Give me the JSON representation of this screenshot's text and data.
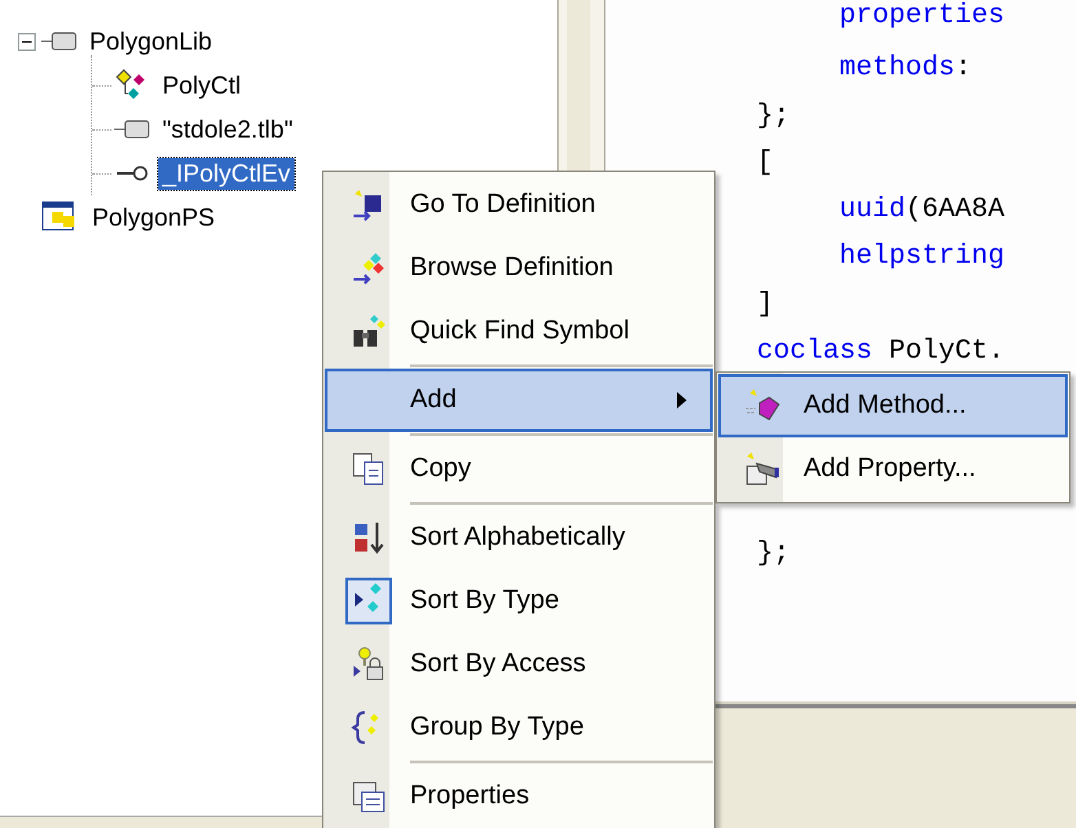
{
  "tree": {
    "nodes": [
      {
        "label": "PolygonLib",
        "kind": "library",
        "expanded": true,
        "selected": false,
        "children": [
          {
            "label": "PolyCtl",
            "kind": "coclass",
            "selected": false
          },
          {
            "label": "\"stdole2.tlb\"",
            "kind": "library",
            "selected": false
          },
          {
            "label": "_IPolyCtlEv",
            "kind": "interface",
            "selected": true
          }
        ]
      },
      {
        "label": "PolygonPS",
        "kind": "project",
        "selected": false
      }
    ]
  },
  "code": {
    "lines": [
      {
        "tokens": [
          {
            "text": "     properties",
            "kind": "keyword"
          }
        ]
      },
      {
        "tokens": [
          {
            "text": "     methods",
            "kind": "keyword"
          },
          {
            "text": ":",
            "kind": "plain"
          }
        ]
      },
      {
        "tokens": [
          {
            "text": "};",
            "kind": "plain"
          }
        ]
      },
      {
        "tokens": [
          {
            "text": "[",
            "kind": "plain"
          }
        ]
      },
      {
        "tokens": [
          {
            "text": "     uuid",
            "kind": "keyword"
          },
          {
            "text": "(6AA8A",
            "kind": "plain"
          }
        ]
      },
      {
        "tokens": [
          {
            "text": "     helpstring",
            "kind": "keyword"
          }
        ]
      },
      {
        "tokens": [
          {
            "text": "]",
            "kind": "plain"
          }
        ]
      },
      {
        "tokens": [
          {
            "text": "coclass",
            "kind": "keyword"
          },
          {
            "text": " PolyCt.",
            "kind": "plain"
          }
        ]
      }
    ],
    "tail_lines": [
      {
        "tokens": [
          {
            "text": "};",
            "kind": "plain"
          }
        ]
      }
    ]
  },
  "context_menu": {
    "items": [
      {
        "kind": "item",
        "label": "Go To Definition",
        "selected": false,
        "checked": false,
        "has_submenu": false
      },
      {
        "kind": "item",
        "label": "Browse Definition",
        "selected": false,
        "checked": false,
        "has_submenu": false
      },
      {
        "kind": "item",
        "label": "Quick Find Symbol",
        "selected": false,
        "checked": false,
        "has_submenu": false
      },
      {
        "kind": "separator"
      },
      {
        "kind": "item",
        "label": "Add",
        "selected": true,
        "checked": false,
        "has_submenu": true
      },
      {
        "kind": "separator"
      },
      {
        "kind": "item",
        "label": "Copy",
        "selected": false,
        "checked": false,
        "has_submenu": false
      },
      {
        "kind": "separator"
      },
      {
        "kind": "item",
        "label": "Sort Alphabetically",
        "selected": false,
        "checked": false,
        "has_submenu": false
      },
      {
        "kind": "item",
        "label": "Sort By Type",
        "selected": false,
        "checked": true,
        "has_submenu": false
      },
      {
        "kind": "item",
        "label": "Sort By Access",
        "selected": false,
        "checked": false,
        "has_submenu": false
      },
      {
        "kind": "item",
        "label": "Group By Type",
        "selected": false,
        "checked": false,
        "has_submenu": false
      },
      {
        "kind": "separator"
      },
      {
        "kind": "item",
        "label": "Properties",
        "selected": false,
        "checked": false,
        "has_submenu": false
      }
    ]
  },
  "submenu": {
    "items": [
      {
        "label": "Add Method...",
        "selected": true
      },
      {
        "label": "Add Property...",
        "selected": false
      }
    ]
  }
}
